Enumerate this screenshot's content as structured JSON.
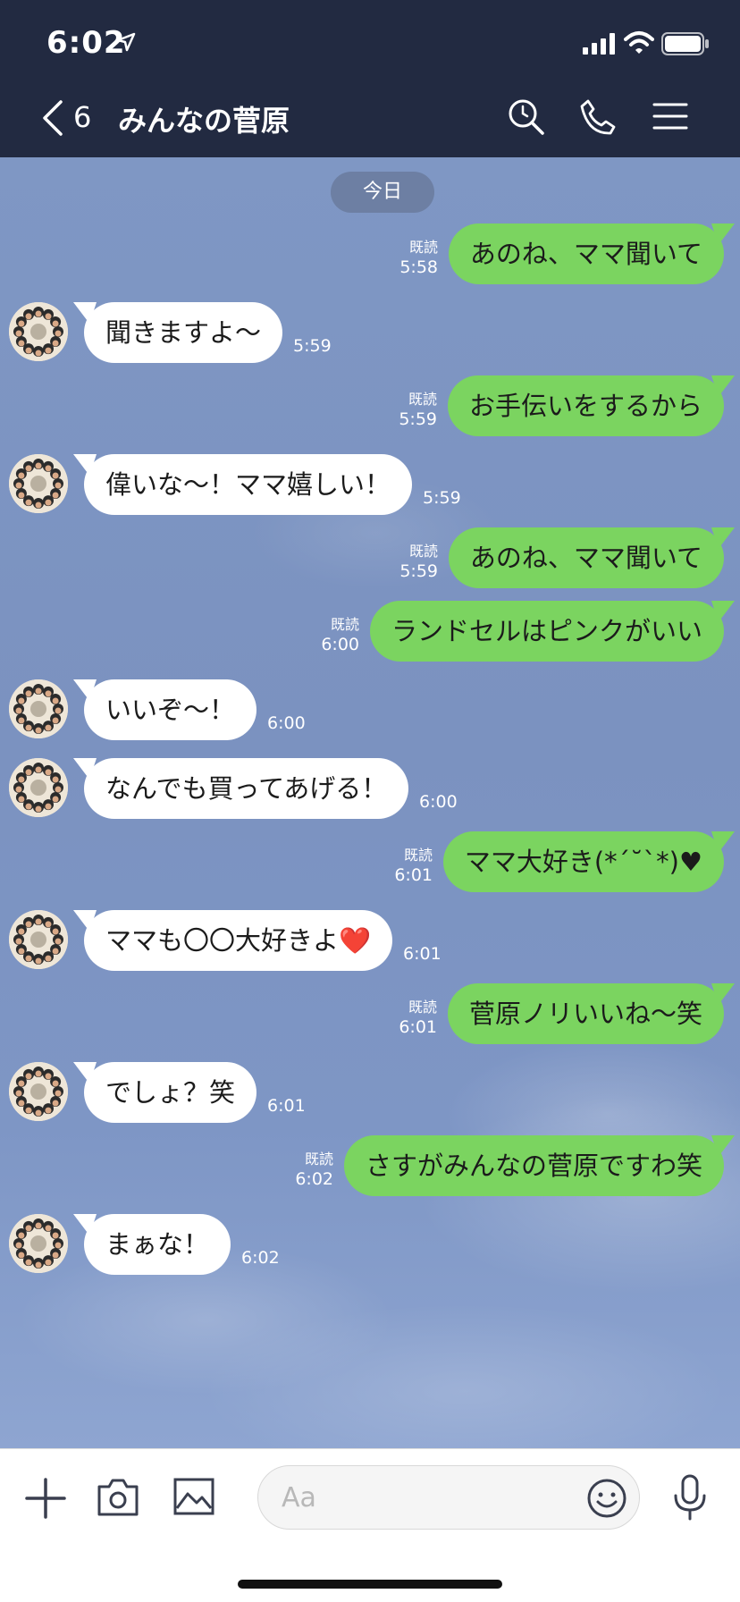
{
  "status_bar": {
    "time": "6:02"
  },
  "nav": {
    "back_count": "6",
    "title": "みんなの菅原"
  },
  "date_label": "今日",
  "messages": [
    {
      "side": "out",
      "text": "あのね、ママ聞いて",
      "read": "既読",
      "time": "5:58"
    },
    {
      "side": "in",
      "text": "聞きますよ〜",
      "time": "5:59"
    },
    {
      "side": "out",
      "text": "お手伝いをするから",
      "read": "既読",
      "time": "5:59"
    },
    {
      "side": "in",
      "text": "偉いな〜！ママ嬉しい！",
      "time": "5:59"
    },
    {
      "side": "out",
      "text": "あのね、ママ聞いて",
      "read": "既読",
      "time": "5:59"
    },
    {
      "side": "out",
      "text": "ランドセルはピンクがいい",
      "read": "既読",
      "time": "6:00"
    },
    {
      "side": "in",
      "text": "いいぞ〜！",
      "time": "6:00"
    },
    {
      "side": "in",
      "text": "なんでも買ってあげる！",
      "time": "6:00"
    },
    {
      "side": "out",
      "text": "ママ大好き(*´˘`*)♥",
      "read": "既読",
      "time": "6:01"
    },
    {
      "side": "in",
      "text": "ママも〇〇大好きよ❤️",
      "time": "6:01"
    },
    {
      "side": "out",
      "text": "菅原ノリいいね〜笑",
      "read": "既読",
      "time": "6:01"
    },
    {
      "side": "in",
      "text": "でしょ？笑",
      "time": "6:01"
    },
    {
      "side": "out",
      "text": "さすがみんなの菅原ですわ笑",
      "read": "既読",
      "time": "6:02"
    },
    {
      "side": "in",
      "text": "まぁな！",
      "time": "6:02"
    }
  ],
  "input": {
    "placeholder": "Aa"
  },
  "colors": {
    "header": "#222a41",
    "outgoing_bubble": "#7bd460",
    "incoming_bubble": "#ffffff"
  }
}
